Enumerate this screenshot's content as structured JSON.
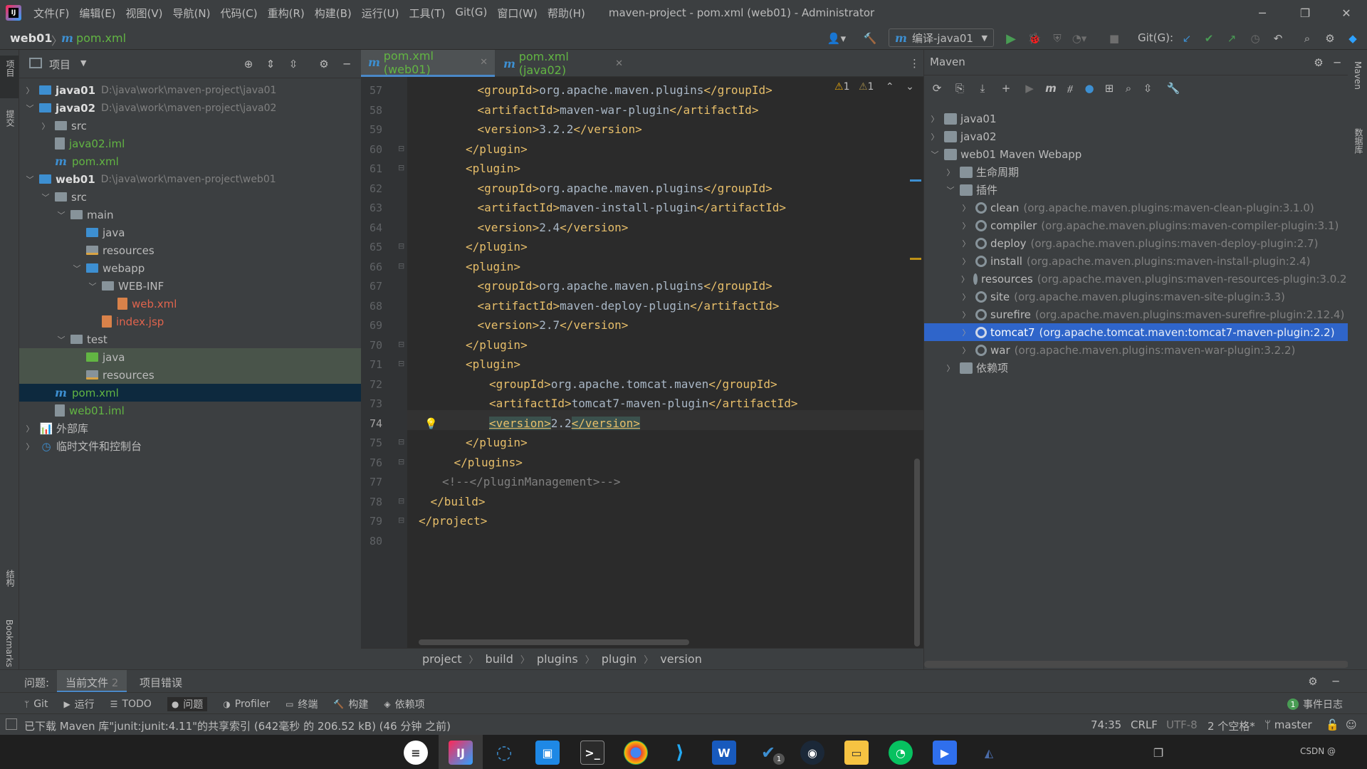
{
  "titlebar": {
    "menu": [
      "文件(F)",
      "编辑(E)",
      "视图(V)",
      "导航(N)",
      "代码(C)",
      "重构(R)",
      "构建(B)",
      "运行(U)",
      "工具(T)",
      "Git(G)",
      "窗口(W)",
      "帮助(H)"
    ],
    "title": "maven-project - pom.xml (web01) - Administrator",
    "logo": "IJ"
  },
  "navbar": {
    "module": "web01",
    "file": "pom.xml",
    "run_config": "编译-java01",
    "git_label": "Git(G):"
  },
  "left_stripe": {
    "project": "项目",
    "commit": "提交",
    "structure": "结构",
    "bookmarks": "Bookmarks"
  },
  "project": {
    "title": "项目",
    "tree": [
      {
        "label": "java01",
        "path": "D:\\java\\work\\maven-project\\java01"
      },
      {
        "label": "java02",
        "path": "D:\\java\\work\\maven-project\\java02"
      },
      {
        "label": "src"
      },
      {
        "label": "java02.iml"
      },
      {
        "label": "pom.xml"
      },
      {
        "label": "web01",
        "path": "D:\\java\\work\\maven-project\\web01"
      },
      {
        "label": "src"
      },
      {
        "label": "main"
      },
      {
        "label": "java"
      },
      {
        "label": "resources"
      },
      {
        "label": "webapp"
      },
      {
        "label": "WEB-INF"
      },
      {
        "label": "web.xml"
      },
      {
        "label": "index.jsp"
      },
      {
        "label": "test"
      },
      {
        "label": "java"
      },
      {
        "label": "resources"
      },
      {
        "label": "pom.xml"
      },
      {
        "label": "web01.iml"
      },
      {
        "label": "外部库"
      },
      {
        "label": "临时文件和控制台"
      }
    ]
  },
  "editor": {
    "tabs": [
      {
        "label": "pom.xml (web01)"
      },
      {
        "label": "pom.xml (java02)"
      }
    ],
    "warnings": "1",
    "weak_warnings": "1",
    "lines": [
      {
        "n": "57",
        "indent": 5,
        "tag1": "<groupId>",
        "text": "org.apache.maven.plugins",
        "tag2": "</groupId>"
      },
      {
        "n": "58",
        "indent": 5,
        "tag1": "<artifactId>",
        "text": "maven-war-plugin",
        "tag2": "</artifactId>"
      },
      {
        "n": "59",
        "indent": 5,
        "tag1": "<version>",
        "text": "3.2.2",
        "tag2": "</version>"
      },
      {
        "n": "60",
        "indent": 4,
        "tag1": "</plugin>",
        "text": "",
        "tag2": ""
      },
      {
        "n": "61",
        "indent": 4,
        "tag1": "<plugin>",
        "text": "",
        "tag2": ""
      },
      {
        "n": "62",
        "indent": 5,
        "tag1": "<groupId>",
        "text": "org.apache.maven.plugins",
        "tag2": "</groupId>"
      },
      {
        "n": "63",
        "indent": 5,
        "tag1": "<artifactId>",
        "text": "maven-install-plugin",
        "tag2": "</artifactId>"
      },
      {
        "n": "64",
        "indent": 5,
        "tag1": "<version>",
        "text": "2.4",
        "tag2": "</version>"
      },
      {
        "n": "65",
        "indent": 4,
        "tag1": "</plugin>",
        "text": "",
        "tag2": ""
      },
      {
        "n": "66",
        "indent": 4,
        "tag1": "<plugin>",
        "text": "",
        "tag2": ""
      },
      {
        "n": "67",
        "indent": 5,
        "tag1": "<groupId>",
        "text": "org.apache.maven.plugins",
        "tag2": "</groupId>"
      },
      {
        "n": "68",
        "indent": 5,
        "tag1": "<artifactId>",
        "text": "maven-deploy-plugin",
        "tag2": "</artifactId>"
      },
      {
        "n": "69",
        "indent": 5,
        "tag1": "<version>",
        "text": "2.7",
        "tag2": "</version>"
      },
      {
        "n": "70",
        "indent": 4,
        "tag1": "</plugin>",
        "text": "",
        "tag2": ""
      },
      {
        "n": "71",
        "indent": 4,
        "tag1": "<plugin>",
        "text": "",
        "tag2": ""
      },
      {
        "n": "72",
        "indent": 6,
        "tag1": "<groupId>",
        "text": "org.apache.tomcat.maven",
        "tag2": "</groupId>"
      },
      {
        "n": "73",
        "indent": 6,
        "tag1": "<artifactId>",
        "text": "tomcat7-maven-plugin",
        "tag2": "</artifactId>"
      },
      {
        "n": "74",
        "indent": 6,
        "tag1": "<version>",
        "text": "2.2",
        "tag2": "</version>"
      },
      {
        "n": "75",
        "indent": 4,
        "tag1": "</plugin>",
        "text": "",
        "tag2": ""
      },
      {
        "n": "76",
        "indent": 3,
        "tag1": "</plugins>",
        "text": "",
        "tag2": ""
      },
      {
        "n": "77",
        "indent": 2,
        "tag1": "",
        "text": "",
        "tag2": "",
        "comment": "<!--</pluginManagement>-->"
      },
      {
        "n": "78",
        "indent": 1,
        "tag1": "</build>",
        "text": "",
        "tag2": ""
      },
      {
        "n": "79",
        "indent": 0,
        "tag1": "</project>",
        "text": "",
        "tag2": ""
      },
      {
        "n": "80",
        "indent": 0,
        "tag1": "",
        "text": "",
        "tag2": ""
      }
    ],
    "breadcrumb": [
      "project",
      "build",
      "plugins",
      "plugin",
      "version"
    ]
  },
  "maven": {
    "title": "Maven",
    "tree": [
      {
        "label": "java01"
      },
      {
        "label": "java02"
      },
      {
        "label": "web01 Maven Webapp"
      },
      {
        "label": "生命周期"
      },
      {
        "label": "插件"
      },
      {
        "label": "clean",
        "detail": "(org.apache.maven.plugins:maven-clean-plugin:3.1.0)"
      },
      {
        "label": "compiler",
        "detail": "(org.apache.maven.plugins:maven-compiler-plugin:3.1)"
      },
      {
        "label": "deploy",
        "detail": "(org.apache.maven.plugins:maven-deploy-plugin:2.7)"
      },
      {
        "label": "install",
        "detail": "(org.apache.maven.plugins:maven-install-plugin:2.4)"
      },
      {
        "label": "resources",
        "detail": "(org.apache.maven.plugins:maven-resources-plugin:3.0.2)"
      },
      {
        "label": "site",
        "detail": "(org.apache.maven.plugins:maven-site-plugin:3.3)"
      },
      {
        "label": "surefire",
        "detail": "(org.apache.maven.plugins:maven-surefire-plugin:2.12.4)"
      },
      {
        "label": "tomcat7",
        "detail": "(org.apache.tomcat.maven:tomcat7-maven-plugin:2.2)"
      },
      {
        "label": "war",
        "detail": "(org.apache.maven.plugins:maven-war-plugin:3.2.2)"
      },
      {
        "label": "依赖项"
      }
    ]
  },
  "right_stripe": {
    "maven": "Maven",
    "database": "数据库"
  },
  "problems": {
    "label": "问题:",
    "current_file": "当前文件",
    "current_file_count": "2",
    "project_errors": "项目错误"
  },
  "toolwindows": [
    "Git",
    "运行",
    "TODO",
    "问题",
    "Profiler",
    "终端",
    "构建",
    "依赖项"
  ],
  "event_log": {
    "label": "事件日志",
    "count": "1"
  },
  "status": {
    "message": "已下载 Maven 库\"junit:junit:4.11\"的共享索引 (642毫秒 的 206.52 kB) (46 分钟 之前)",
    "position": "74:35",
    "line_sep": "CRLF",
    "encoding": "UTF-8",
    "indent": "2 个空格*",
    "branch": "master"
  },
  "taskbar": {
    "watermark": "CSDN @",
    "badge": "1"
  },
  "colors": {
    "accent": "#3d8fd1",
    "selection": "#2f65ca",
    "tree_selected": "#0d293e",
    "test_bg": "#49544a",
    "xml_tag": "#e8bf6a",
    "green": "#499c54"
  }
}
